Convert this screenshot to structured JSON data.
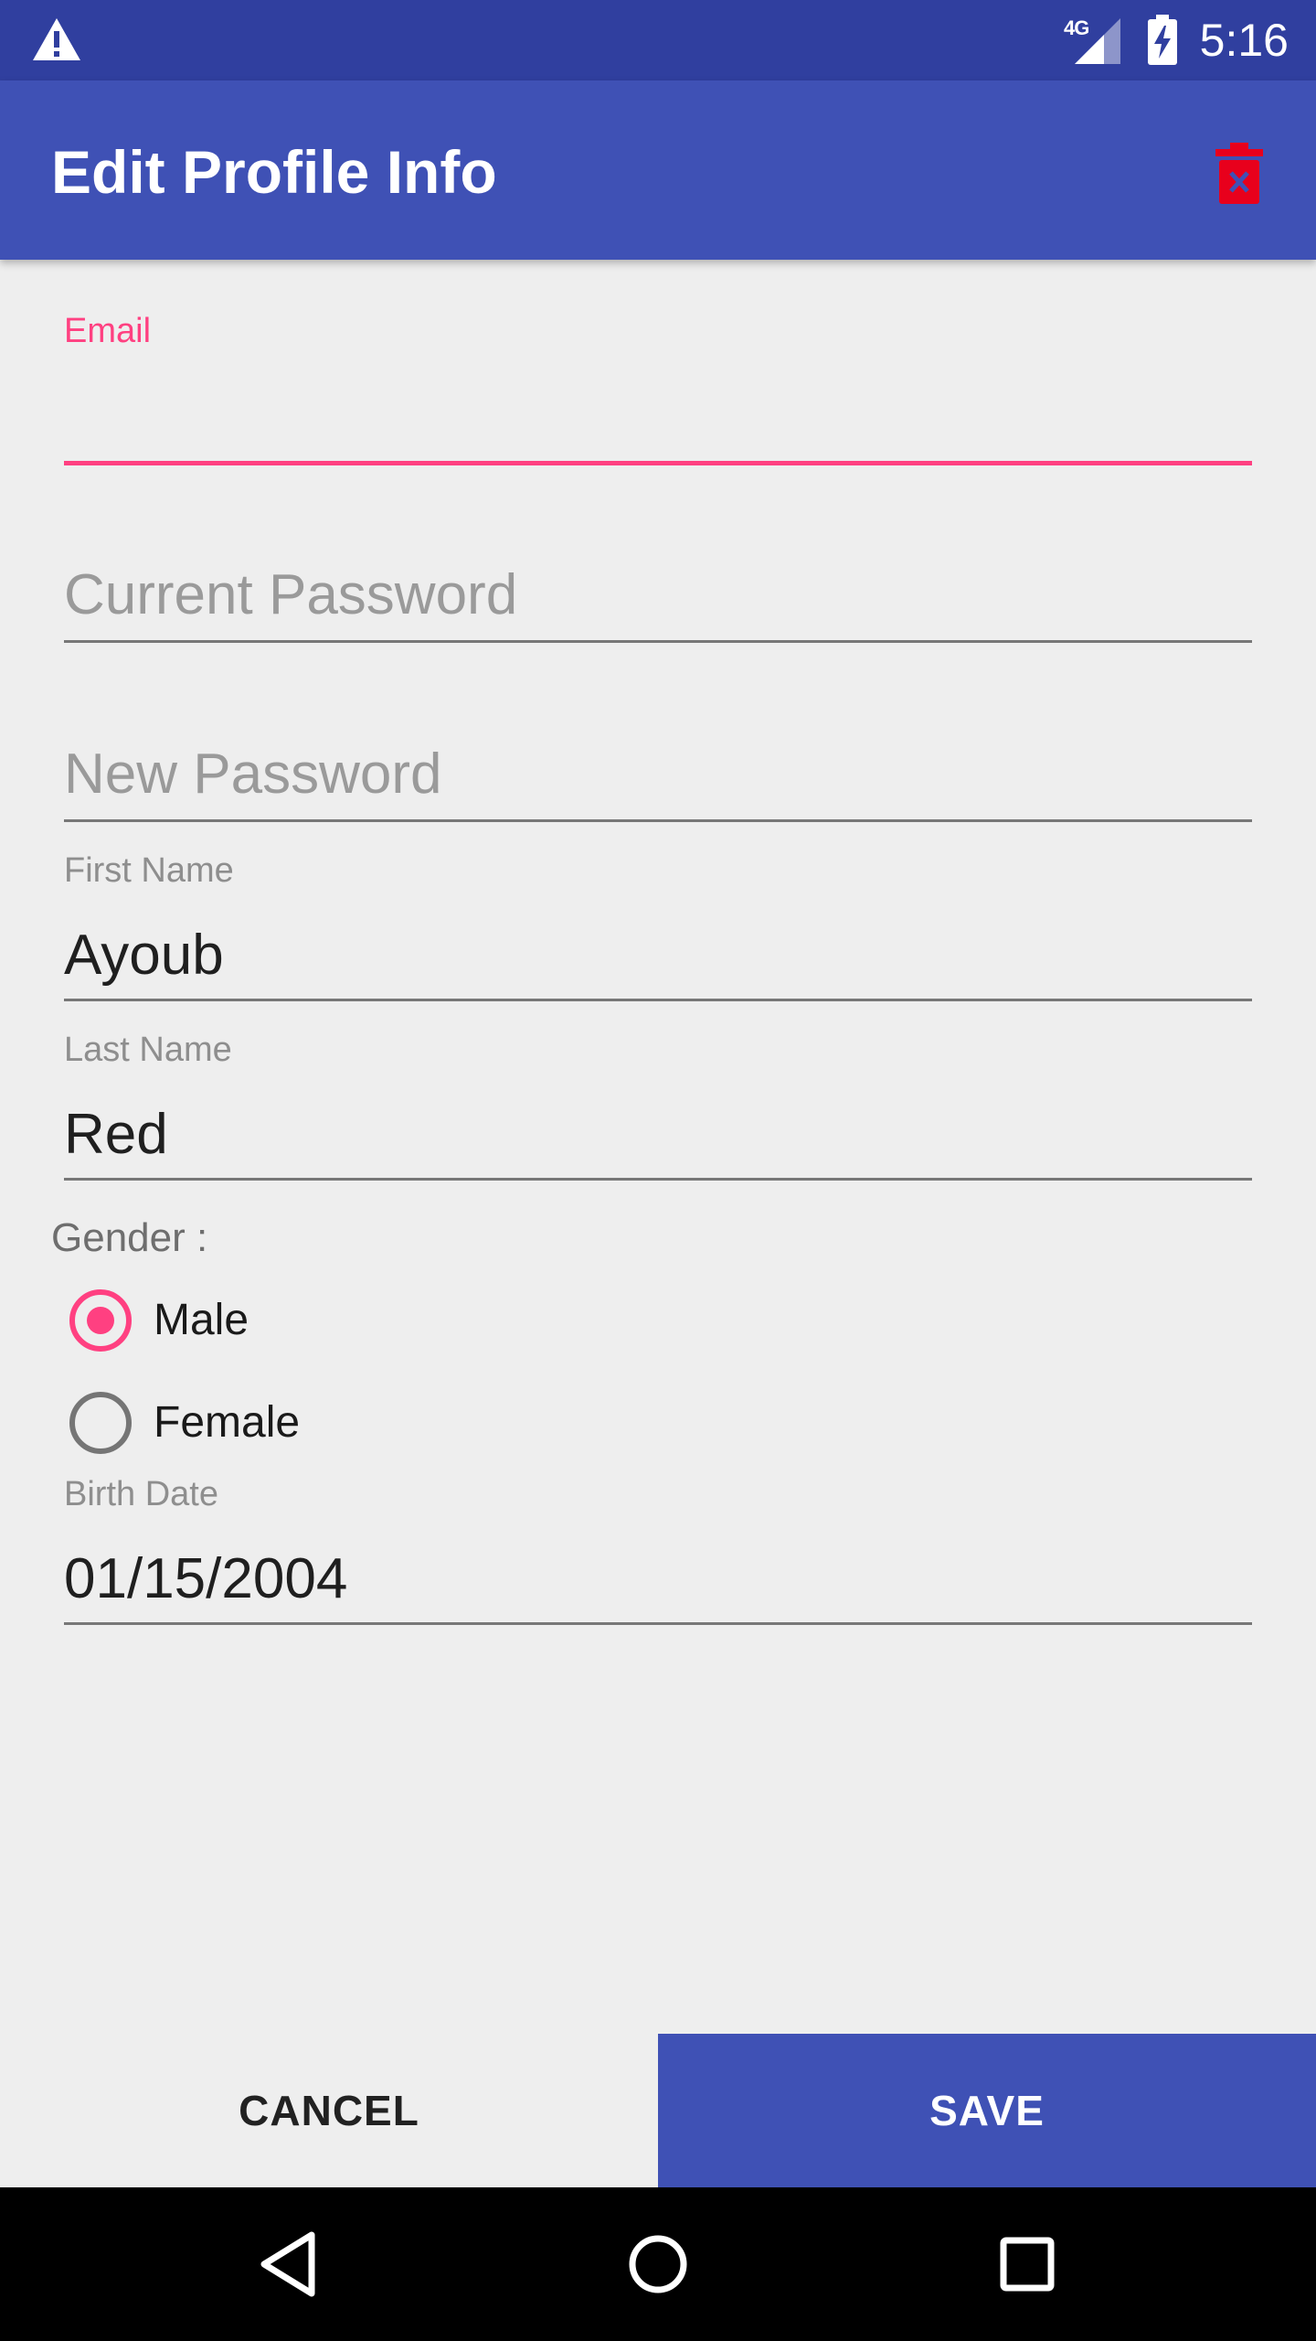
{
  "status_bar": {
    "time": "5:16",
    "network": "4G",
    "icons": [
      "warning-icon",
      "signal-icon",
      "battery-charging-icon"
    ]
  },
  "app_bar": {
    "title": "Edit Profile Info",
    "action_icon": "delete-icon",
    "action_color": "#e8001c"
  },
  "form": {
    "email": {
      "label": "Email",
      "value": ""
    },
    "current_password": {
      "placeholder": "Current Password",
      "value": ""
    },
    "new_password": {
      "placeholder": "New Password",
      "value": ""
    },
    "first_name": {
      "label": "First Name",
      "value": "Ayoub"
    },
    "last_name": {
      "label": "Last Name",
      "value": "Red"
    },
    "gender": {
      "label": "Gender :",
      "options": [
        "Male",
        "Female"
      ],
      "selected": "Male"
    },
    "birth_date": {
      "label": "Birth Date",
      "value": "01/15/2004"
    }
  },
  "buttons": {
    "cancel": "CANCEL",
    "save": "SAVE"
  },
  "nav_bar": {
    "icons": [
      "back-icon",
      "home-icon",
      "recents-icon"
    ]
  },
  "colors": {
    "primary": "#3f51b5",
    "primary_dark": "#303f9f",
    "accent": "#ff4081",
    "background": "#eeeeee"
  }
}
